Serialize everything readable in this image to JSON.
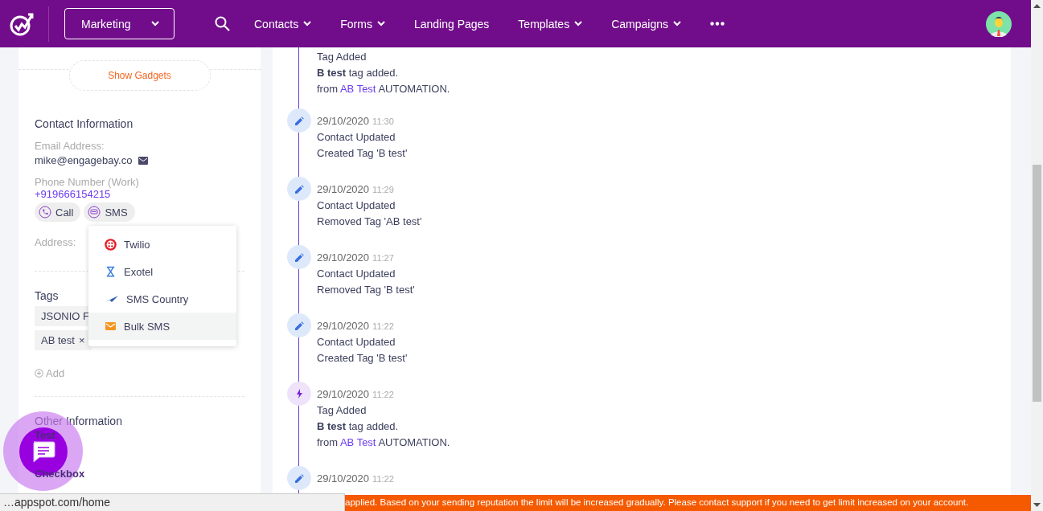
{
  "header": {
    "module": "Marketing",
    "nav_items": [
      {
        "label": "Contacts",
        "has_menu": true
      },
      {
        "label": "Forms",
        "has_menu": true
      },
      {
        "label": "Landing Pages",
        "has_menu": false
      },
      {
        "label": "Templates",
        "has_menu": true
      },
      {
        "label": "Campaigns",
        "has_menu": true
      }
    ]
  },
  "contact_panel": {
    "gadgets_button": "Show Gadgets",
    "contact_title": "Contact Information",
    "email_label": "Email Address:",
    "email": "mike@engagebay.co",
    "phone_label": "Phone Number (Work)",
    "phone": "+919666154215",
    "actions": [
      {
        "kind": "call",
        "label": "Call"
      },
      {
        "kind": "sms",
        "label": "SMS"
      }
    ],
    "address_label": "Address:",
    "tags_title": "Tags",
    "tags": [
      {
        "label": "JSONIO F"
      },
      {
        "label": "AB test",
        "remove_symbol": "×"
      }
    ],
    "add_label": "Add",
    "other_title": "Other Information",
    "other_fields": [
      "Test",
      "Checkbox"
    ]
  },
  "sms_menu": [
    {
      "kind": "twilio",
      "label": "Twilio",
      "highlighted": false
    },
    {
      "kind": "exotel",
      "label": "Exotel",
      "highlighted": false
    },
    {
      "kind": "smscountry",
      "label": "SMS Country",
      "highlighted": false
    },
    {
      "kind": "bulksms",
      "label": "Bulk SMS",
      "highlighted": true
    }
  ],
  "timeline": [
    {
      "title": "Tag Added",
      "detail": "**B test** tag added.",
      "source_prefix": "from",
      "source_link": "AB Test",
      "source_suffix": "AUTOMATION."
    },
    {
      "kind": "update",
      "date": "29/10/2020",
      "time": "11:30",
      "title": "Contact Updated",
      "detail": "Created Tag 'B test'"
    },
    {
      "kind": "update",
      "date": "29/10/2020",
      "time": "11:29",
      "title": "Contact Updated",
      "detail": "Removed Tag 'AB test'"
    },
    {
      "kind": "update",
      "date": "29/10/2020",
      "time": "11:27",
      "title": "Contact Updated",
      "detail": "Removed Tag 'B test'"
    },
    {
      "kind": "update",
      "date": "29/10/2020",
      "time": "11:22",
      "title": "Contact Updated",
      "detail": "Created Tag 'B test'"
    },
    {
      "kind": "tag",
      "date": "29/10/2020",
      "time": "11:22",
      "title": "Tag Added",
      "detail": "**B test** tag added.",
      "source_prefix": "from",
      "source_link": "AB Test",
      "source_suffix": "AUTOMATION."
    },
    {
      "kind": "update",
      "date": "29/10/2020",
      "time": "11:22"
    }
  ],
  "status_url": "…appspot.com/home",
  "banner": "applied. Based on your sending reputation the limit will be increased gradually. Please contact support if you need to get limit increased on your account."
}
